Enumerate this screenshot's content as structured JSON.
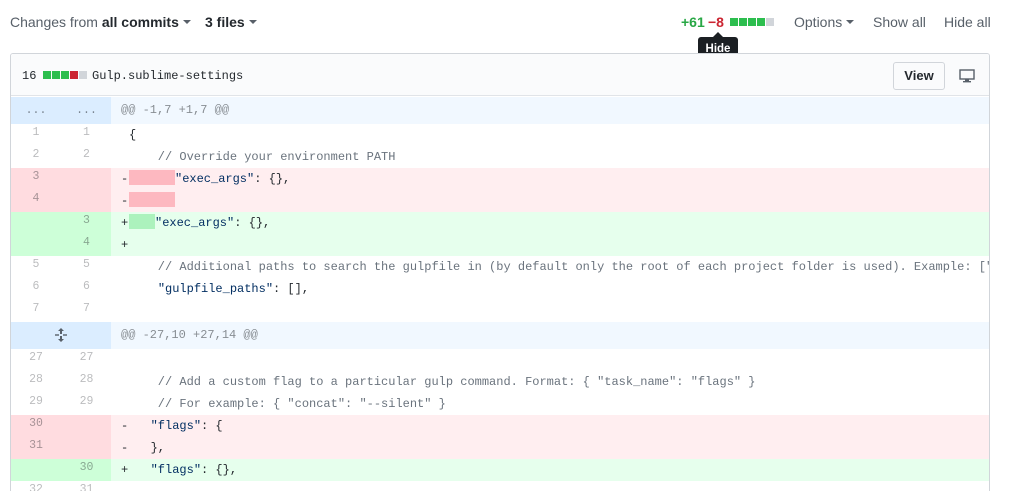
{
  "toolbar": {
    "changes_prefix": "Changes from ",
    "changes_value": "all commits",
    "files_label": "3 files",
    "additions": "+61",
    "deletions": "−8",
    "options_label": "Options",
    "show_all_label": "Show all",
    "hide_all_label": "Hide all",
    "tooltip": "Hide"
  },
  "file": {
    "change_count": "16",
    "name": "Gulp.sublime-settings",
    "view_label": "View"
  },
  "hunks": [
    {
      "header": "@@ -1,7 +1,7 @@",
      "left": "...",
      "right": "..."
    },
    {
      "header": "@@ -27,10 +27,14 @@"
    }
  ],
  "lines": [
    {
      "type": "ctx",
      "l": "1",
      "r": "1",
      "text": "{"
    },
    {
      "type": "ctx",
      "l": "2",
      "r": "2",
      "text": "    // Override your environment PATH"
    },
    {
      "type": "del",
      "l": "3",
      "r": "",
      "marker": "-",
      "key": "\"exec_args\"",
      "rest": ": {},"
    },
    {
      "type": "del",
      "l": "4",
      "r": "",
      "marker": "-",
      "key": "",
      "rest": ""
    },
    {
      "type": "add",
      "l": "",
      "r": "3",
      "marker": "+",
      "key": "\"exec_args\"",
      "rest": ": {},"
    },
    {
      "type": "add",
      "l": "",
      "r": "4",
      "marker": "+",
      "key": "",
      "rest": ""
    },
    {
      "type": "ctx",
      "l": "5",
      "r": "5",
      "text": "    // Additional paths to search the gulpfile in (by default only the root of each project folder is used). Example: [\"src\", \"nest"
    },
    {
      "type": "ctx",
      "l": "6",
      "r": "6",
      "key": "\"gulpfile_paths\"",
      "rest": ": [],"
    },
    {
      "type": "ctx",
      "l": "7",
      "r": "7",
      "text": ""
    },
    {
      "type": "ctx",
      "l": "27",
      "r": "27",
      "text": ""
    },
    {
      "type": "ctx",
      "l": "28",
      "r": "28",
      "text": "    // Add a custom flag to a particular gulp command. Format: { \"task_name\": \"flags\" }"
    },
    {
      "type": "ctx",
      "l": "29",
      "r": "29",
      "text": "    // For example: { \"concat\": \"--silent\" }"
    },
    {
      "type": "del",
      "l": "30",
      "r": "",
      "marker": "-",
      "key": "\"flags\"",
      "rest": ": {"
    },
    {
      "type": "del",
      "l": "31",
      "r": "",
      "marker": "-",
      "key": "",
      "rest": "},"
    },
    {
      "type": "add",
      "l": "",
      "r": "30",
      "marker": "+",
      "key": "\"flags\"",
      "rest": ": {},"
    },
    {
      "type": "ctx",
      "l": "32",
      "r": "31",
      "text": ""
    }
  ],
  "colors": {
    "addition": "#28a745",
    "deletion": "#cb2431",
    "hunk_bg": "#f1f8ff",
    "del_bg": "#ffeef0",
    "add_bg": "#e6ffed"
  },
  "icons": {
    "desktop": "desktop-icon",
    "expand": "unfold-icon"
  }
}
